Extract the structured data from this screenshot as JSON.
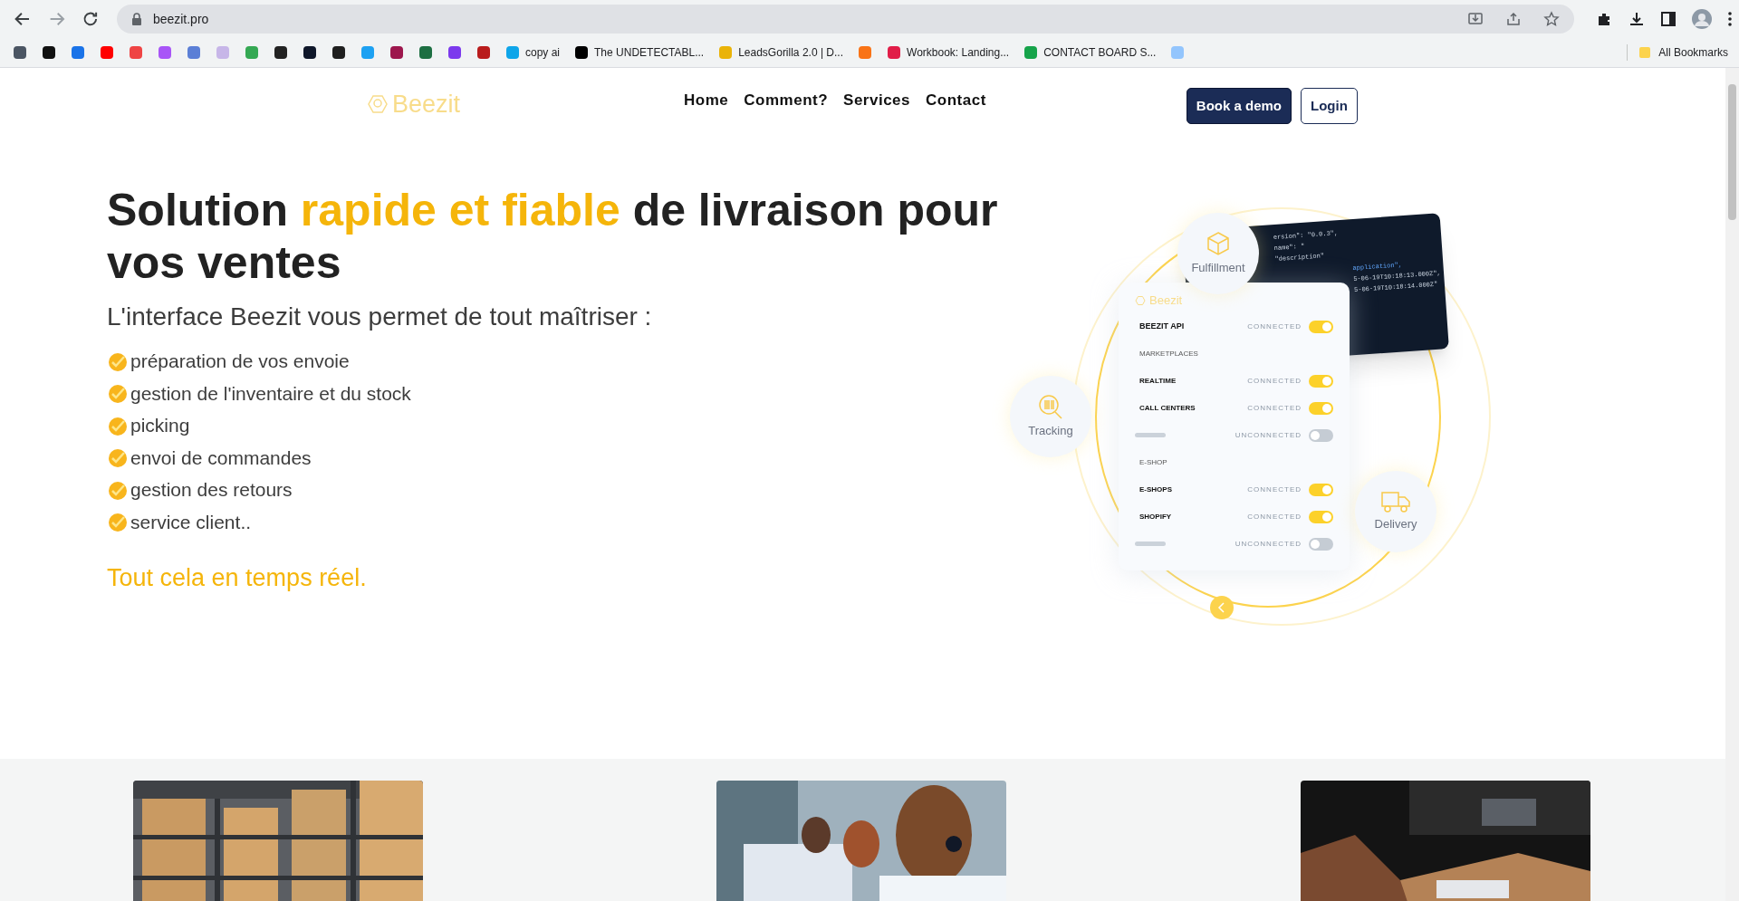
{
  "browser": {
    "url": "beezit.pro",
    "bookmarks": [
      {
        "color": "#4b5563"
      },
      {
        "color": "#111111"
      },
      {
        "color": "#1a73e8"
      },
      {
        "color": "#ff0000"
      },
      {
        "color": "#ef4444"
      },
      {
        "color": "#a855f7"
      },
      {
        "color": "#5b7fd6"
      },
      {
        "color": "#c7b6e8"
      },
      {
        "color": "#34a853"
      },
      {
        "color": "#222222"
      },
      {
        "color": "#0f172a"
      },
      {
        "color": "#1f1f1f"
      },
      {
        "color": "#1da1f2"
      },
      {
        "color": "#9d174d"
      },
      {
        "color": "#1d6f42"
      },
      {
        "color": "#7c3aed"
      },
      {
        "color": "#b91c1c"
      },
      {
        "color": "#0ea5e9",
        "label": "copy ai"
      },
      {
        "color": "#000000",
        "label": "The UNDETECTABL..."
      },
      {
        "color": "#eab308",
        "label": "LeadsGorilla 2.0 | D..."
      },
      {
        "color": "#f97316"
      },
      {
        "color": "#e11d48",
        "label": "Workbook: Landing..."
      },
      {
        "color": "#16a34a",
        "label": "CONTACT BOARD S..."
      },
      {
        "color": "#93c5fd"
      }
    ],
    "all_bookmarks": "All Bookmarks"
  },
  "header": {
    "logo": "Beezit",
    "nav": [
      "Home",
      "Comment?",
      "Services",
      "Contact"
    ],
    "buttons": [
      {
        "label": "Book a demo",
        "kind": "primary"
      },
      {
        "label": "Login",
        "kind": "outline"
      }
    ]
  },
  "hero": {
    "title": "Solution **rapide et fiable** de livraison pour vos ventes",
    "subtitle": "L'interface Beezit vous permet de tout maîtriser :",
    "features": [
      "préparation de vos envoie",
      "gestion de l'inventaire et du stock",
      "picking",
      "envoi de commandes",
      "gestion des retours",
      "service client.."
    ],
    "tagline": "Tout cela en temps réel."
  },
  "illustration": {
    "bubbles": [
      {
        "kind": "box",
        "label": "Fulfillment"
      },
      {
        "kind": "barcode",
        "label": "Tracking"
      },
      {
        "kind": "truck",
        "label": "Delivery"
      }
    ],
    "code_lines": [
      "ersion\": \"0.0.3\",",
      "name\": \"",
      "\"description\"",
      "application\",",
      "5-06-19T10:18:13.000Z\",",
      "5-06-19T10:18:14.000Z\""
    ],
    "panel_logo": "Beezit",
    "rows": [
      {
        "kind": "toggle",
        "label": "BEEZIT API",
        "status": "CONNECTED",
        "on": true
      },
      {
        "kind": "section",
        "label": "MARKETPLACES"
      },
      {
        "kind": "toggle",
        "label": "REALTIME",
        "status": "CONNECTED",
        "on": true
      },
      {
        "kind": "toggle",
        "label": "CALL CENTERS",
        "status": "CONNECTED",
        "on": true
      },
      {
        "kind": "blank",
        "status": "UNCONNECTED",
        "on": false
      },
      {
        "kind": "section",
        "label": "E-SHOP"
      },
      {
        "kind": "toggle",
        "label": "E-SHOPS",
        "status": "CONNECTED",
        "on": true
      },
      {
        "kind": "toggle",
        "label": "SHOPIFY",
        "status": "CONNECTED",
        "on": true
      },
      {
        "kind": "blank",
        "status": "UNCONNECTED",
        "on": false
      }
    ]
  }
}
